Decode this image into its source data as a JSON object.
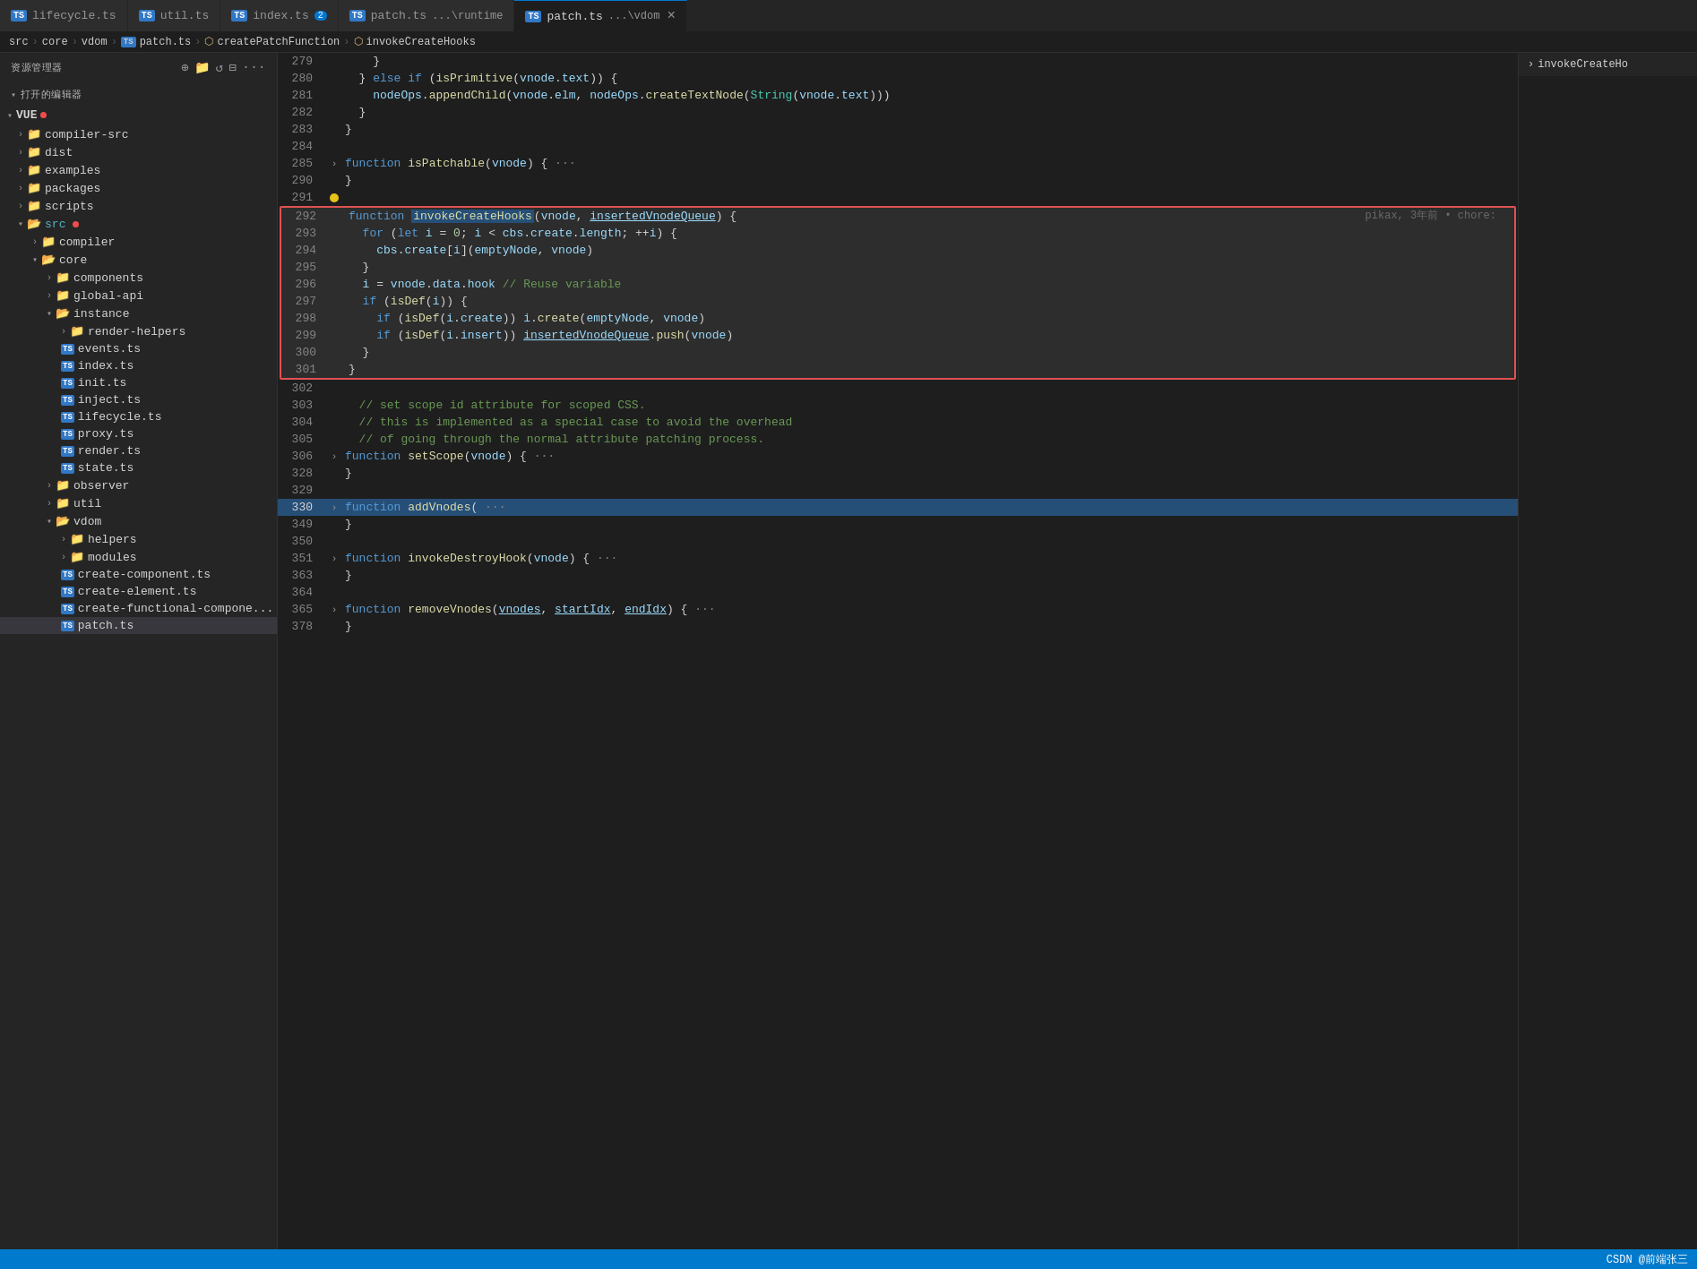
{
  "tabs": [
    {
      "id": "lifecycle",
      "label": "lifecycle.ts",
      "active": false,
      "modified": false
    },
    {
      "id": "util",
      "label": "util.ts",
      "active": false,
      "modified": false
    },
    {
      "id": "index",
      "label": "index.ts",
      "active": false,
      "modified": false,
      "badge": "2"
    },
    {
      "id": "patch-runtime",
      "label": "patch.ts",
      "path": "...\\runtime",
      "active": false,
      "modified": false
    },
    {
      "id": "patch-vdom",
      "label": "patch.ts",
      "path": "...\\vdom",
      "active": true,
      "modified": false,
      "closable": true
    }
  ],
  "breadcrumb": {
    "parts": [
      "src",
      "core",
      "vdom",
      "patch.ts",
      "createPatchFunction",
      "invokeCreateHooks"
    ]
  },
  "sidebar": {
    "title": "资源管理器",
    "open_editors_label": "打开的编辑器",
    "tree": {
      "root": "VUE",
      "items": [
        {
          "id": "compiler-src",
          "label": "compiler-src",
          "type": "folder",
          "indent": 1,
          "collapsed": true
        },
        {
          "id": "dist",
          "label": "dist",
          "type": "folder",
          "indent": 1,
          "collapsed": true
        },
        {
          "id": "examples",
          "label": "examples",
          "type": "folder",
          "indent": 1,
          "collapsed": true
        },
        {
          "id": "packages",
          "label": "packages",
          "type": "folder",
          "indent": 1,
          "collapsed": true
        },
        {
          "id": "scripts",
          "label": "scripts",
          "type": "folder",
          "indent": 1,
          "collapsed": true
        },
        {
          "id": "src",
          "label": "src",
          "type": "folder",
          "indent": 1,
          "open": true,
          "badge": true
        },
        {
          "id": "compiler",
          "label": "compiler",
          "type": "folder",
          "indent": 2,
          "collapsed": true
        },
        {
          "id": "core",
          "label": "core",
          "type": "folder",
          "indent": 2,
          "open": true
        },
        {
          "id": "components",
          "label": "components",
          "type": "folder",
          "indent": 3,
          "collapsed": true
        },
        {
          "id": "global-api",
          "label": "global-api",
          "type": "folder",
          "indent": 3,
          "collapsed": true
        },
        {
          "id": "instance",
          "label": "instance",
          "type": "folder",
          "indent": 3,
          "open": true
        },
        {
          "id": "render-helpers",
          "label": "render-helpers",
          "type": "folder",
          "indent": 4,
          "collapsed": true
        },
        {
          "id": "events.ts",
          "label": "events.ts",
          "type": "ts",
          "indent": 4
        },
        {
          "id": "index.ts-inst",
          "label": "index.ts",
          "type": "ts",
          "indent": 4
        },
        {
          "id": "init.ts",
          "label": "init.ts",
          "type": "ts",
          "indent": 4
        },
        {
          "id": "inject.ts",
          "label": "inject.ts",
          "type": "ts",
          "indent": 4
        },
        {
          "id": "lifecycle.ts-inst",
          "label": "lifecycle.ts",
          "type": "ts",
          "indent": 4
        },
        {
          "id": "proxy.ts",
          "label": "proxy.ts",
          "type": "ts",
          "indent": 4
        },
        {
          "id": "render.ts",
          "label": "render.ts",
          "type": "ts",
          "indent": 4
        },
        {
          "id": "state.ts",
          "label": "state.ts",
          "type": "ts",
          "indent": 4
        },
        {
          "id": "observer",
          "label": "observer",
          "type": "folder",
          "indent": 3,
          "collapsed": true
        },
        {
          "id": "util",
          "label": "util",
          "type": "folder",
          "indent": 3,
          "collapsed": true
        },
        {
          "id": "vdom",
          "label": "vdom",
          "type": "folder",
          "indent": 3,
          "open": true
        },
        {
          "id": "helpers",
          "label": "helpers",
          "type": "folder",
          "indent": 4,
          "collapsed": true
        },
        {
          "id": "modules",
          "label": "modules",
          "type": "folder",
          "indent": 4,
          "collapsed": true
        },
        {
          "id": "create-component.ts",
          "label": "create-component.ts",
          "type": "ts",
          "indent": 4
        },
        {
          "id": "create-element.ts",
          "label": "create-element.ts",
          "type": "ts",
          "indent": 4
        },
        {
          "id": "create-functional-component",
          "label": "create-functional-compone...",
          "type": "ts",
          "indent": 4
        },
        {
          "id": "patch.ts-side",
          "label": "patch.ts",
          "type": "ts",
          "indent": 4,
          "active": true
        }
      ]
    }
  },
  "code": {
    "lines": [
      {
        "num": 279,
        "content": "    }",
        "indent": 4
      },
      {
        "num": 280,
        "content": "  } else if (isPrimitive(vnode.text)) {",
        "indent": 2
      },
      {
        "num": 281,
        "content": "    nodeOps.appendChild(vnode.elm, nodeOps.createTextNode(String(vnode.text)))",
        "indent": 4
      },
      {
        "num": 282,
        "content": "  }",
        "indent": 2
      },
      {
        "num": 283,
        "content": "}",
        "indent": 0
      },
      {
        "num": 284,
        "content": "",
        "indent": 0
      },
      {
        "num": 285,
        "content": "function isPatchable(vnode) { ···",
        "indent": 0,
        "collapsible": true
      },
      {
        "num": 290,
        "content": "}",
        "indent": 0
      },
      {
        "num": 291,
        "content": "",
        "indent": 0,
        "has_dot": true
      },
      {
        "num": 292,
        "content": "function invokeCreateHooks(vnode, insertedVnodeQueue) {",
        "indent": 0,
        "highlighted": true,
        "meta": "pikax, 3年前 • chore:"
      },
      {
        "num": 293,
        "content": "  for (let i = 0; i < cbs.create.length; ++i) {",
        "indent": 2,
        "highlighted": true
      },
      {
        "num": 294,
        "content": "    cbs.create[i](emptyNode, vnode)",
        "indent": 4,
        "highlighted": true
      },
      {
        "num": 295,
        "content": "  }",
        "indent": 2,
        "highlighted": true
      },
      {
        "num": 296,
        "content": "  i = vnode.data.hook // Reuse variable",
        "indent": 2,
        "highlighted": true
      },
      {
        "num": 297,
        "content": "  if (isDef(i)) {",
        "indent": 2,
        "highlighted": true
      },
      {
        "num": 298,
        "content": "    if (isDef(i.create)) i.create(emptyNode, vnode)",
        "indent": 4,
        "highlighted": true
      },
      {
        "num": 299,
        "content": "    if (isDef(i.insert)) insertedVnodeQueue.push(vnode)",
        "indent": 4,
        "highlighted": true
      },
      {
        "num": 300,
        "content": "  }",
        "indent": 2,
        "highlighted": true
      },
      {
        "num": 301,
        "content": "}",
        "indent": 0,
        "highlighted": true
      },
      {
        "num": 302,
        "content": "",
        "indent": 0
      },
      {
        "num": 303,
        "content": "  // set scope id attribute for scoped CSS.",
        "indent": 2,
        "comment": true
      },
      {
        "num": 304,
        "content": "  // this is implemented as a special case to avoid the overhead",
        "indent": 2,
        "comment": true
      },
      {
        "num": 305,
        "content": "  // of going through the normal attribute patching process.",
        "indent": 2,
        "comment": true
      },
      {
        "num": 306,
        "content": "function setScope(vnode) { ···",
        "indent": 0,
        "collapsible": true
      },
      {
        "num": 328,
        "content": "}",
        "indent": 0
      },
      {
        "num": 329,
        "content": "",
        "indent": 0
      },
      {
        "num": 330,
        "content": "function addVnodes( ···",
        "indent": 0,
        "collapsible": true
      },
      {
        "num": 349,
        "content": "}",
        "indent": 0
      },
      {
        "num": 350,
        "content": "",
        "indent": 0
      },
      {
        "num": 351,
        "content": "function invokeDestroyHook(vnode) { ···",
        "indent": 0,
        "collapsible": true
      },
      {
        "num": 363,
        "content": "}",
        "indent": 0
      },
      {
        "num": 364,
        "content": "",
        "indent": 0
      },
      {
        "num": 365,
        "content": "function removeVnodes(vnodes, startIdx, endIdx) { ···",
        "indent": 0,
        "collapsible": true
      },
      {
        "num": 378,
        "content": "}",
        "indent": 0
      }
    ]
  },
  "right_panel": {
    "label": "invokeCreateHo"
  },
  "status_bar": {
    "text": "CSDN @前端张三"
  }
}
